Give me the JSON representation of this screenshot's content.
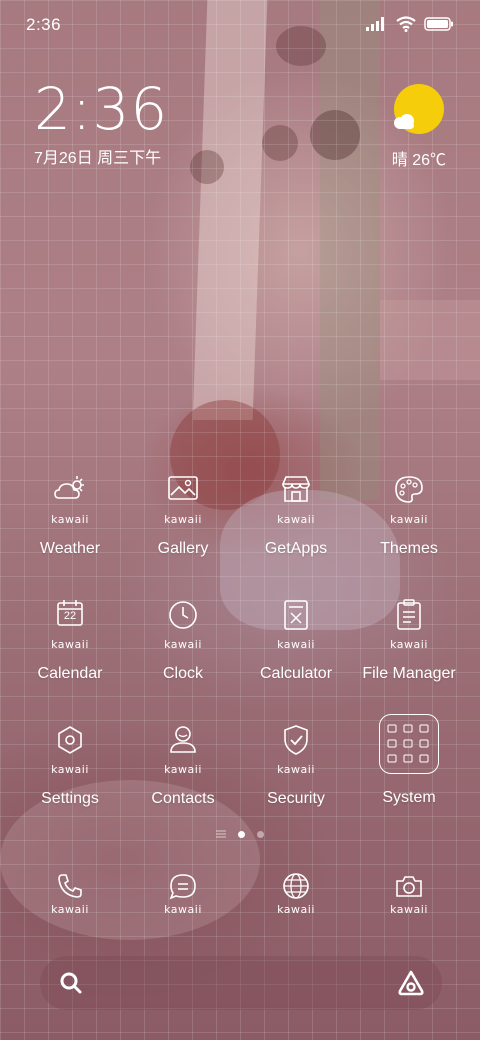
{
  "status_bar": {
    "time": "2:36",
    "signal_icon": "cellular-signal-icon",
    "wifi_icon": "wifi-icon",
    "battery_icon": "battery-icon"
  },
  "clock_widget": {
    "time": "2:36",
    "date": "7月26日 周三下午"
  },
  "weather_widget": {
    "icon": "sun-cloud-icon",
    "text": "晴 26℃"
  },
  "badge_text": "kawaii",
  "apps": [
    {
      "label": "Weather",
      "icon": "weather-icon"
    },
    {
      "label": "Gallery",
      "icon": "gallery-icon"
    },
    {
      "label": "GetApps",
      "icon": "store-icon"
    },
    {
      "label": "Themes",
      "icon": "palette-icon"
    },
    {
      "label": "Calendar",
      "icon": "calendar-icon",
      "icon_text": "22"
    },
    {
      "label": "Clock",
      "icon": "clock-icon"
    },
    {
      "label": "Calculator",
      "icon": "calculator-icon"
    },
    {
      "label": "File Manager",
      "icon": "file-manager-icon"
    },
    {
      "label": "Settings",
      "icon": "settings-icon"
    },
    {
      "label": "Contacts",
      "icon": "contacts-icon"
    },
    {
      "label": "Security",
      "icon": "shield-icon"
    },
    {
      "label": "System",
      "icon": "folder-icon"
    }
  ],
  "page_indicator": {
    "pages": 2,
    "current": 1
  },
  "dock": [
    {
      "icon": "phone-icon"
    },
    {
      "icon": "messages-icon"
    },
    {
      "icon": "browser-icon"
    },
    {
      "icon": "camera-icon"
    }
  ],
  "search_bar": {
    "left_icon": "search-icon",
    "right_icon": "assistant-icon"
  },
  "colors": {
    "accent_sun": "#f6cd0b",
    "text": "#ffffff"
  }
}
